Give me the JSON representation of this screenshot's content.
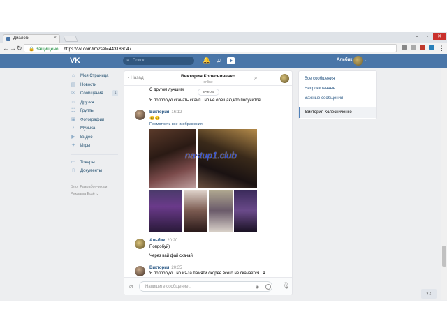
{
  "browser": {
    "tab_title": "Диалоги",
    "tab_close": "×",
    "window_controls": [
      "–",
      "▫",
      "✕"
    ],
    "secure_label": "Защищено",
    "url": "https://vk.com/im?sel=443186047"
  },
  "header": {
    "logo": "VK",
    "search_placeholder": "Поиск",
    "user_name": "Альбик",
    "caret": "⌄"
  },
  "sidebar": {
    "items": [
      {
        "label": "Моя Страница",
        "icon": "home-icon"
      },
      {
        "label": "Новости",
        "icon": "news-icon"
      },
      {
        "label": "Сообщения",
        "icon": "messages-icon",
        "badge": "1"
      },
      {
        "label": "Друзья",
        "icon": "friends-icon"
      },
      {
        "label": "Группы",
        "icon": "groups-icon"
      },
      {
        "label": "Фотографии",
        "icon": "photos-icon"
      },
      {
        "label": "Музыка",
        "icon": "music-icon"
      },
      {
        "label": "Видео",
        "icon": "video-icon"
      },
      {
        "label": "Игры",
        "icon": "games-icon"
      }
    ],
    "extra": [
      {
        "label": "Товары",
        "icon": "goods-icon"
      },
      {
        "label": "Документы",
        "icon": "docs-icon"
      }
    ],
    "footer_line1": "Блог  Разработчикам",
    "footer_line2": "Реклама  Ещё ⌄"
  },
  "dialog": {
    "back_label": "Назад",
    "title": "Виктория Колесниченко",
    "status": "online",
    "more": "···",
    "messages": {
      "m0_text": "С другом лучшим",
      "date_divider": "вчера",
      "m1_text": "Я попробую скачать скайп...но не обещаю,что получится",
      "m2_author": "Виктория",
      "m2_time": "16:12",
      "m2_emoji": "😖😖",
      "m2_link": "Посмотреть все изображения",
      "m3_author": "Альбик",
      "m3_time": "20:20",
      "m3_text1": "Попробуй)",
      "m3_text2": "Через вай фай скачай",
      "m4_author": "Виктория",
      "m4_time": "20:35",
      "m4_text": "Я попробую...но из-за памяти скорее всего не скачается...я"
    },
    "watermark": "nastup1.club",
    "compose_placeholder": "Напишите сообщение..."
  },
  "right_panel": {
    "items": [
      "Все сообщения",
      "Непрочитанные",
      "Важные сообщения"
    ],
    "selected": "Виктория Колесниченко"
  },
  "zoom_label": "▾ 2"
}
